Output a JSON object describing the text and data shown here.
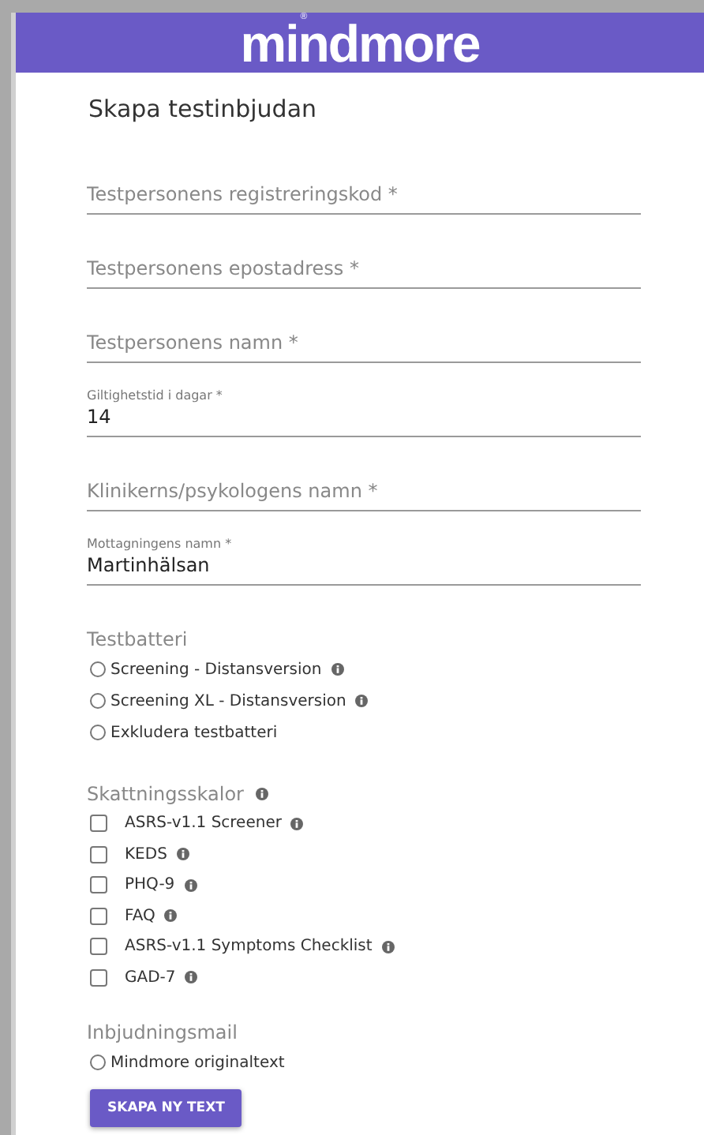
{
  "header": {
    "logo": "mindmore",
    "logo_mark": "®"
  },
  "title": "Skapa testinbjudan",
  "fields": [
    {
      "placeholder": "Testpersonens registreringskod *"
    },
    {
      "placeholder": "Testpersonens epostadress *"
    },
    {
      "placeholder": "Testpersonens namn *"
    },
    {
      "label": "Giltighetstid i dagar *",
      "value": "14"
    },
    {
      "placeholder": "Klinikerns/psykologens namn *"
    },
    {
      "label": "Mottagningens namn *",
      "value": "Martinhälsan"
    }
  ],
  "test_battery": {
    "heading": "Testbatteri",
    "options": [
      {
        "label": "Screening - Distansversion",
        "info": true,
        "selected": false
      },
      {
        "label": "Screening XL - Distansversion",
        "info": true,
        "selected": false
      },
      {
        "label": "Exkludera testbatteri",
        "info": false,
        "selected": false
      }
    ]
  },
  "rating_scales": {
    "heading": "Skattningsskalor",
    "info": true,
    "items": [
      {
        "label": "ASRS-v1.1 Screener",
        "checked": false
      },
      {
        "label": "KEDS",
        "checked": false
      },
      {
        "label": "PHQ-9",
        "checked": false
      },
      {
        "label": "FAQ",
        "checked": false
      },
      {
        "label": "ASRS-v1.1 Symptoms Checklist",
        "checked": false
      },
      {
        "label": "GAD-7",
        "checked": false
      }
    ]
  },
  "invitation_mail": {
    "heading": "Inbjudningsmail",
    "options": [
      {
        "label": "Mindmore originaltext",
        "selected": false
      }
    ],
    "button": "SKAPA NY TEXT"
  }
}
